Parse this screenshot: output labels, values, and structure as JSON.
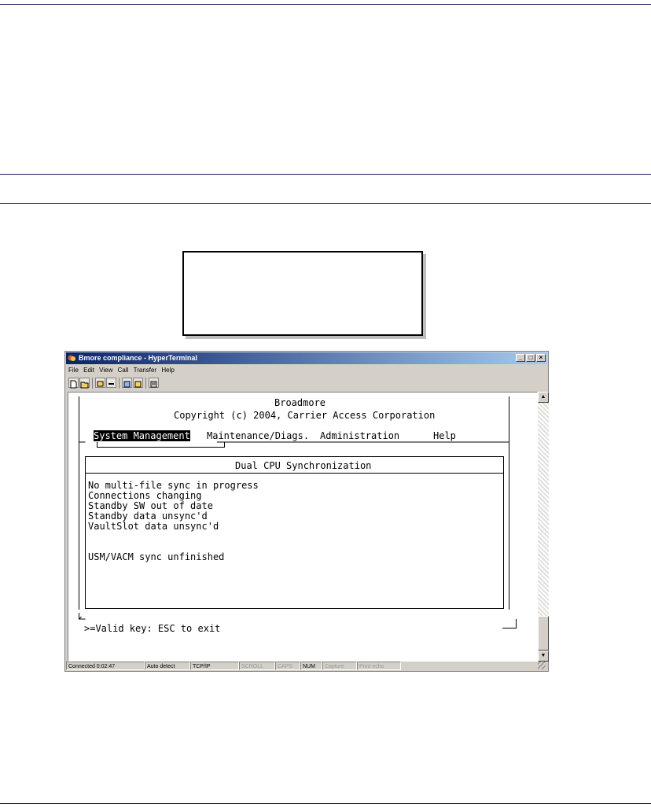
{
  "window": {
    "title": "Bmore compliance - HyperTerminal",
    "controls": {
      "minimize": "_",
      "maximize": "□",
      "close": "×"
    }
  },
  "menu": [
    "File",
    "Edit",
    "View",
    "Call",
    "Transfer",
    "Help"
  ],
  "toolbar_icons": [
    "new-icon",
    "open-icon",
    "connect-icon",
    "disconnect-icon",
    "send-icon",
    "receive-icon",
    "properties-icon"
  ],
  "terminal": {
    "product": "Broadmore",
    "copyright": "Copyright (c) 2004, Carrier Access Corporation",
    "menu": {
      "selected": "System Management",
      "items": [
        "Maintenance/Diags.",
        "Administration",
        "Help"
      ]
    },
    "panel_title": "Dual CPU Synchronization",
    "status_lines": [
      "No multi-file sync in progress",
      "Connections changing",
      "Standby SW out of date",
      "Standby data unsync'd",
      "VaultSlot data unsync'd"
    ],
    "extra_line": "USM/VACM sync unfinished",
    "prompt": ">=Valid key: ESC to exit"
  },
  "statusbar": {
    "connected": "Connected 0:02:47",
    "detect": "Auto detect",
    "protocol": "TCP/IP",
    "scroll": "SCROLL",
    "caps": "CAPS",
    "num": "NUM",
    "capture": "Capture",
    "print_echo": "Print echo"
  }
}
